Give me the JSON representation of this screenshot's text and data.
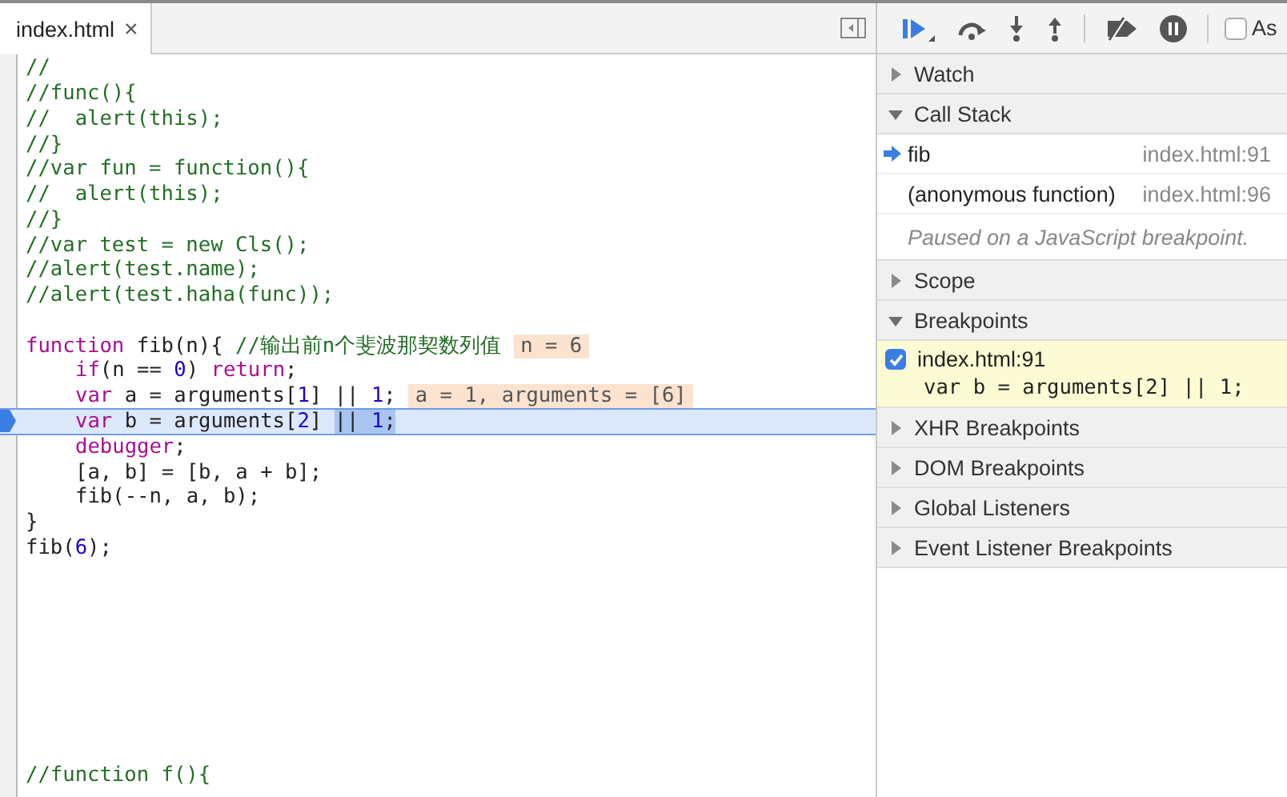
{
  "editor": {
    "tab": {
      "title": "index.html",
      "close": "×"
    },
    "lines": [
      {
        "kind": "code",
        "tokens": [
          {
            "text": "//",
            "kind": "comment"
          }
        ]
      },
      {
        "kind": "code",
        "tokens": [
          {
            "text": "//func(){",
            "kind": "comment"
          }
        ]
      },
      {
        "kind": "code",
        "tokens": [
          {
            "text": "//  alert(this);",
            "kind": "comment"
          }
        ]
      },
      {
        "kind": "code",
        "tokens": [
          {
            "text": "//}",
            "kind": "comment"
          }
        ]
      },
      {
        "kind": "code",
        "tokens": [
          {
            "text": "//var fun = function(){",
            "kind": "comment"
          }
        ]
      },
      {
        "kind": "code",
        "tokens": [
          {
            "text": "//  alert(this);",
            "kind": "comment"
          }
        ]
      },
      {
        "kind": "code",
        "tokens": [
          {
            "text": "//}",
            "kind": "comment"
          }
        ]
      },
      {
        "kind": "code",
        "tokens": [
          {
            "text": "//var test = new Cls();",
            "kind": "comment"
          }
        ]
      },
      {
        "kind": "code",
        "tokens": [
          {
            "text": "//alert(test.name);",
            "kind": "comment"
          }
        ]
      },
      {
        "kind": "code",
        "tokens": [
          {
            "text": "//alert(test.haha(func));",
            "kind": "comment"
          }
        ]
      },
      {
        "kind": "blank"
      },
      {
        "kind": "code",
        "tokens": [
          {
            "text": "function",
            "kind": "keyword"
          },
          {
            "text": " fib(n){ ",
            "kind": "plain"
          },
          {
            "text": "//输出前n个斐波那契数列值",
            "kind": "comment"
          }
        ],
        "inline_value": "n = 6"
      },
      {
        "kind": "indented",
        "tokens": [
          {
            "text": "if",
            "kind": "keyword"
          },
          {
            "text": "(n == ",
            "kind": "plain"
          },
          {
            "text": "0",
            "kind": "number"
          },
          {
            "text": ") ",
            "kind": "plain"
          },
          {
            "text": "return",
            "kind": "keyword"
          },
          {
            "text": ";",
            "kind": "plain"
          }
        ]
      },
      {
        "kind": "indented",
        "tokens": [
          {
            "text": "var",
            "kind": "keyword"
          },
          {
            "text": " a = arguments[",
            "kind": "plain"
          },
          {
            "text": "1",
            "kind": "number"
          },
          {
            "text": "] || ",
            "kind": "plain"
          },
          {
            "text": "1",
            "kind": "number"
          },
          {
            "text": ";",
            "kind": "plain"
          }
        ],
        "inline_value": "a = 1, arguments = [6]"
      },
      {
        "kind": "indented",
        "current": true,
        "tokens": [
          {
            "text": "var",
            "kind": "keyword"
          },
          {
            "text": " b = arguments[",
            "kind": "plain"
          },
          {
            "text": "2",
            "kind": "number"
          },
          {
            "text": "] ",
            "kind": "plain"
          },
          {
            "text": "|| ",
            "kind": "plain",
            "selected": true
          },
          {
            "text": "1",
            "kind": "number",
            "selected": true
          },
          {
            "text": ";",
            "kind": "plain",
            "selected": true
          }
        ]
      },
      {
        "kind": "indented",
        "tokens": [
          {
            "text": "debugger",
            "kind": "keyword"
          },
          {
            "text": ";",
            "kind": "plain"
          }
        ]
      },
      {
        "kind": "indented",
        "tokens": [
          {
            "text": "[a, b] = [b, a + b];",
            "kind": "plain"
          }
        ]
      },
      {
        "kind": "indented",
        "tokens": [
          {
            "text": "fib(--n, a, b);",
            "kind": "plain"
          }
        ]
      },
      {
        "kind": "code",
        "tokens": [
          {
            "text": "}",
            "kind": "plain"
          }
        ]
      },
      {
        "kind": "code",
        "tokens": [
          {
            "text": "fib(",
            "kind": "plain"
          },
          {
            "text": "6",
            "kind": "number"
          },
          {
            "text": ");",
            "kind": "plain"
          }
        ]
      },
      {
        "kind": "blank"
      },
      {
        "kind": "blank"
      },
      {
        "kind": "blank"
      },
      {
        "kind": "blank"
      },
      {
        "kind": "blank"
      },
      {
        "kind": "blank"
      },
      {
        "kind": "blank"
      },
      {
        "kind": "blank"
      },
      {
        "kind": "code",
        "tokens": [
          {
            "text": "//function f(){",
            "kind": "comment"
          }
        ]
      }
    ]
  },
  "debugger": {
    "async_checkbox": {
      "label": "As",
      "checked": false
    },
    "sections": [
      {
        "title": "Watch",
        "expanded": false
      },
      {
        "title": "Call Stack",
        "expanded": true,
        "frames": [
          {
            "name": "fib",
            "location": "index.html:91",
            "selected": true
          },
          {
            "name": "(anonymous function)",
            "location": "index.html:96",
            "selected": false
          }
        ],
        "status": "Paused on a JavaScript breakpoint."
      },
      {
        "title": "Scope",
        "expanded": false
      },
      {
        "title": "Breakpoints",
        "expanded": true,
        "breakpoints": [
          {
            "location": "index.html:91",
            "code": "var b = arguments[2] || 1;",
            "checked": true
          }
        ]
      },
      {
        "title": "XHR Breakpoints",
        "expanded": false
      },
      {
        "title": "DOM Breakpoints",
        "expanded": false
      },
      {
        "title": "Global Listeners",
        "expanded": false
      },
      {
        "title": "Event Listener Breakpoints",
        "expanded": false
      }
    ]
  }
}
